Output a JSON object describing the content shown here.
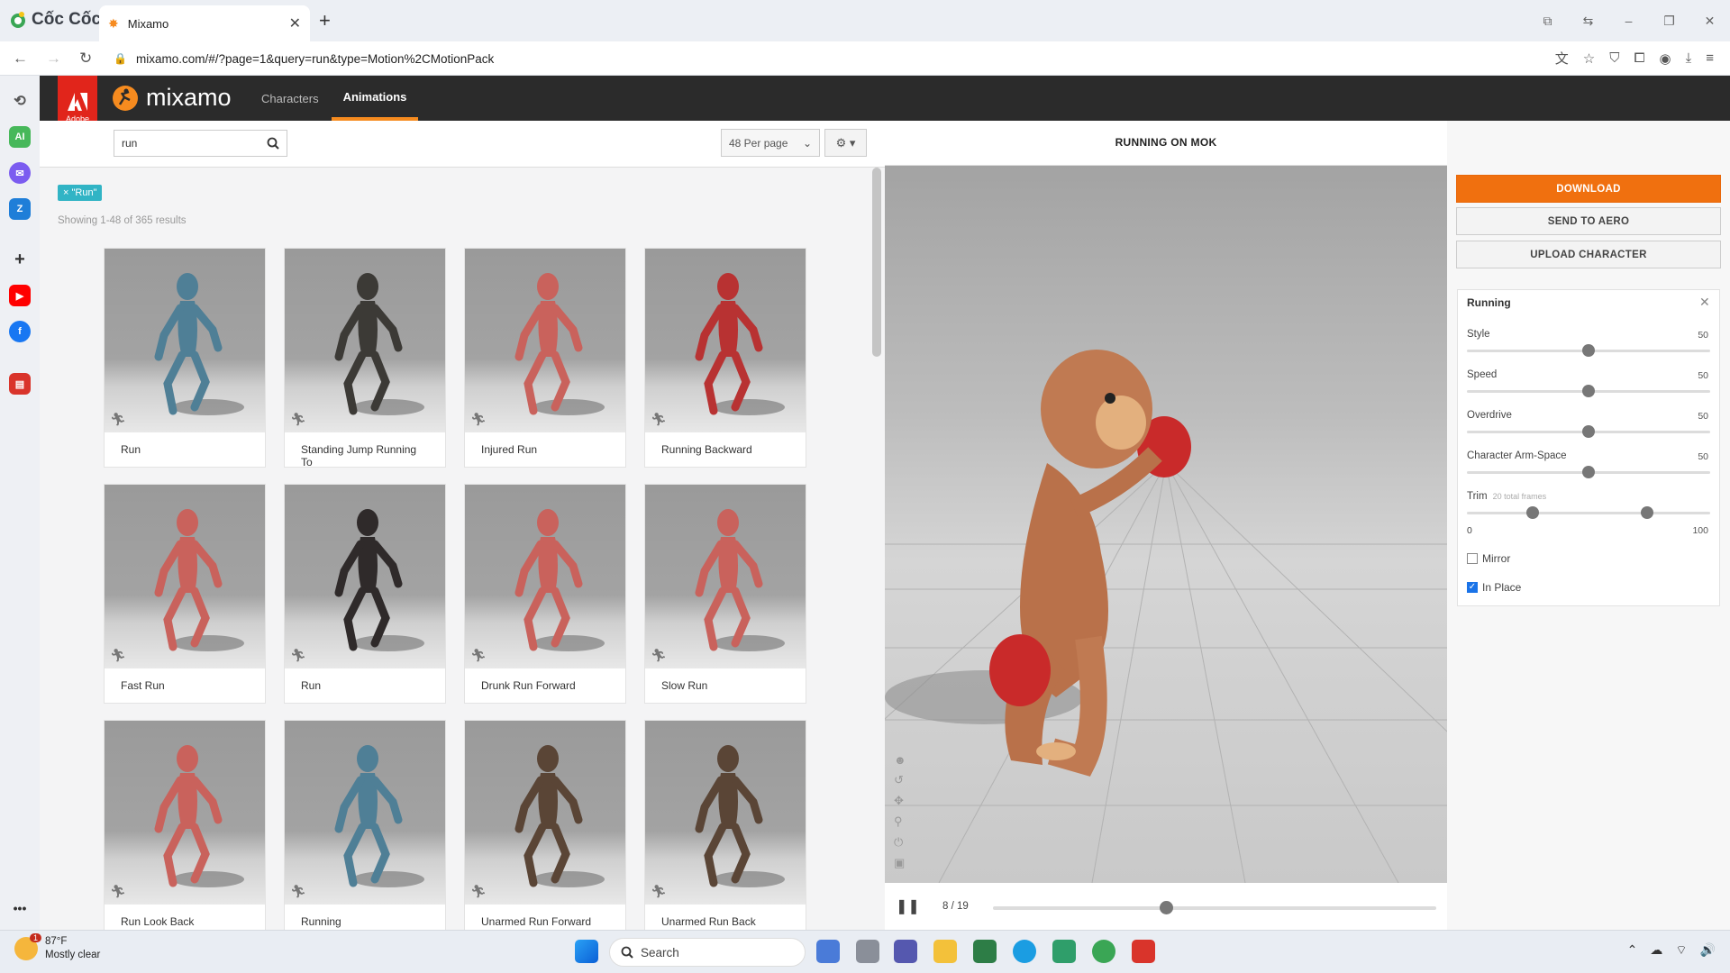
{
  "browser": {
    "name": "Cốc Cốc",
    "tab_title": "Mixamo",
    "tab_close": "✕",
    "new_tab": "+",
    "url": "mixamo.com/#/?page=1&query=run&type=Motion%2CMotionPack",
    "window_controls": [
      "⧉",
      "⇆",
      "–",
      "❐",
      "✕"
    ],
    "sidebar_icons": [
      "history-icon",
      "ai-icon",
      "messenger-icon",
      "zalo-icon",
      "add-icon",
      "youtube-icon",
      "facebook-icon",
      "app-icon",
      "more-icon"
    ]
  },
  "mixamo": {
    "adobe_label": "Adobe",
    "logo": "mixamo",
    "nav": {
      "characters": "Characters",
      "animations": "Animations"
    },
    "search": {
      "value": "run"
    },
    "per_page": "48 Per page",
    "filter_tag": "× \"Run\"",
    "results_text": "Showing 1-48 of 365 results",
    "animations": [
      {
        "label": "Run",
        "color": "#4f7f96"
      },
      {
        "label": "Standing Jump Running To",
        "color": "#3c3a36"
      },
      {
        "label": "Injured Run",
        "color": "#c9625c"
      },
      {
        "label": "Running Backward",
        "color": "#b83232"
      },
      {
        "label": "Fast Run",
        "color": "#c9625c"
      },
      {
        "label": "Run",
        "color": "#2f2a2a"
      },
      {
        "label": "Drunk Run Forward",
        "color": "#c9625c"
      },
      {
        "label": "Slow Run",
        "color": "#c9625c"
      },
      {
        "label": "Run Look Back",
        "color": "#c9625c"
      },
      {
        "label": "Running",
        "color": "#4f7f96"
      },
      {
        "label": "Unarmed Run Forward",
        "color": "#5a4536"
      },
      {
        "label": "Unarmed Run Back",
        "color": "#5a4536"
      }
    ],
    "preview": {
      "title": "RUNNING ON MOK",
      "frame": "8 / 19",
      "progress": 0.39
    },
    "actions": {
      "download": "DOWNLOAD",
      "send": "SEND TO AERO",
      "upload": "UPLOAD CHARACTER"
    },
    "settings": {
      "title": "Running",
      "close": "✕",
      "sliders": [
        {
          "label": "Style",
          "value": "50",
          "level": 0.5
        },
        {
          "label": "Speed",
          "value": "50",
          "level": 0.5
        },
        {
          "label": "Overdrive",
          "value": "50",
          "level": 0.5
        },
        {
          "label": "Character Arm-Space",
          "value": "50",
          "level": 0.5
        }
      ],
      "trim": {
        "label": "Trim",
        "sub": "20 total frames",
        "min": "0",
        "max": "100",
        "start": 0.27,
        "end": 0.74
      },
      "mirror": {
        "label": "Mirror",
        "checked": false
      },
      "in_place": {
        "label": "In Place",
        "checked": true
      }
    }
  },
  "taskbar": {
    "temp": "87°F",
    "weather": "Mostly clear",
    "badge": "1",
    "search_placeholder": "Search"
  }
}
